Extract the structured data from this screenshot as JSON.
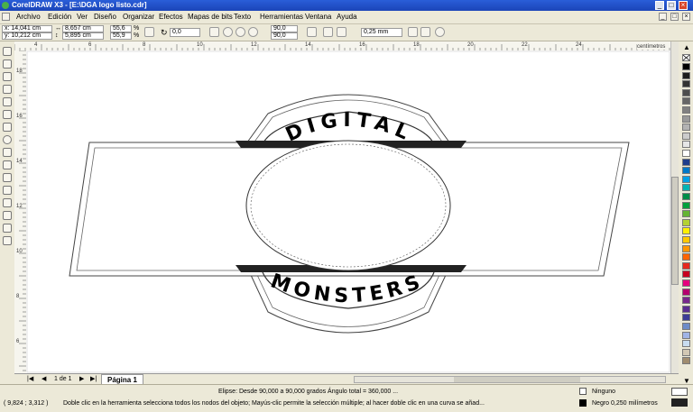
{
  "window": {
    "title": "CorelDRAW X3 - [E:\\DGA logo listo.cdr]",
    "controls": [
      "_",
      "□",
      "×"
    ]
  },
  "menu": [
    "Archivo",
    "Edición",
    "Ver",
    "Diseño",
    "Organizar",
    "Efectos",
    "Mapas de bits",
    "Texto",
    "Herramientas",
    "Ventana",
    "Ayuda"
  ],
  "props": {
    "x": "x: 14,041 cm",
    "y": "y: 10,212 cm",
    "w": "8,657 cm",
    "h": "5,895 cm",
    "sx": "55,6",
    "sy": "55,9",
    "sunit": "%",
    "rotation": "0,0",
    "angle_start": "90,0",
    "angle_end": "90,0",
    "outline": "0,25 mm"
  },
  "ruler": {
    "h_labels": [
      "4",
      "6",
      "8",
      "10",
      "12",
      "14",
      "16",
      "18",
      "20",
      "22",
      "24"
    ],
    "h_unit": "centímetros",
    "v_labels": [
      "18",
      "16",
      "14",
      "12",
      "10",
      "8",
      "6"
    ],
    "v_unit": "centímetros"
  },
  "pagenav": {
    "counter": "1 de 1",
    "tab": "Página 1"
  },
  "artwork": {
    "top_text": "DIGITAL",
    "bottom_text": "MONSTERS"
  },
  "status": {
    "object_info": "Elipse: Desde 90,000 a 90,000 grados  Ángulo total = 360,000 ...",
    "coords": "( 9,824 ; 3,312 )",
    "hint": "Doble clic en la herramienta selecciona todos los nodos del objeto; Mayús-clic permite la selección múltiple; al hacer doble clic en una curva se añad...",
    "fill_label": "Ninguno",
    "outline_label": "Negro  0,250 milímetros"
  },
  "palette_colors": [
    "#000000",
    "#1c1c1c",
    "#333333",
    "#4d4d4d",
    "#666666",
    "#808080",
    "#999999",
    "#b3b3b3",
    "#cccccc",
    "#e6e6e6",
    "#ffffff",
    "#1e3c8c",
    "#0078c8",
    "#00a0e6",
    "#00b4b4",
    "#008c46",
    "#00a03c",
    "#64b432",
    "#b4d232",
    "#fff000",
    "#ffc800",
    "#ff9600",
    "#ff6400",
    "#e6281e",
    "#c8001e",
    "#e6007e",
    "#b4006e",
    "#78288c",
    "#5a2d91",
    "#3c3c96",
    "#6e8cc8",
    "#a0b4e6",
    "#c8dcf0",
    "#d2c8b4",
    "#a08c6e"
  ]
}
